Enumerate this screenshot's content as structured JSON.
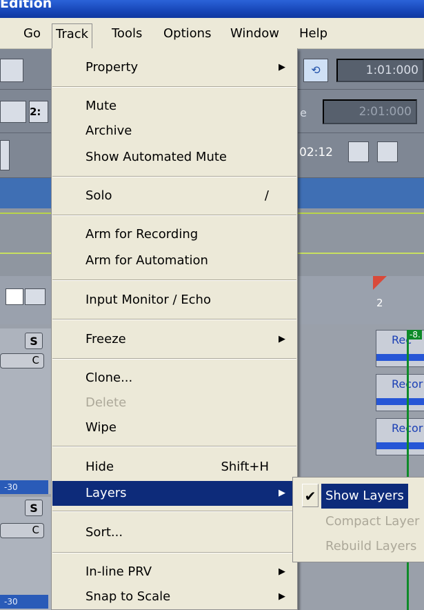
{
  "window": {
    "title": "Edition"
  },
  "menubar": {
    "items": [
      "Go",
      "Track",
      "Tools",
      "Options",
      "Window",
      "Help"
    ]
  },
  "toolbar": {
    "time_main": "1:01:000",
    "time_secondary": "2:01:000",
    "time_secondary_label": "e",
    "time_small": "02:12",
    "marker_label": "2:"
  },
  "track_menu": {
    "items": [
      {
        "label": "Property"
      },
      {
        "label": "Mute"
      },
      {
        "label": "Archive"
      },
      {
        "label": "Show Automated Mute"
      },
      {
        "label": "Solo",
        "shortcut": "/"
      },
      {
        "label": "Arm for Recording"
      },
      {
        "label": "Arm for Automation"
      },
      {
        "label": "Input Monitor / Echo"
      },
      {
        "label": "Freeze"
      },
      {
        "label": "Clone..."
      },
      {
        "label": "Delete"
      },
      {
        "label": "Wipe"
      },
      {
        "label": "Hide",
        "shortcut": "Shift+H"
      },
      {
        "label": "Layers"
      },
      {
        "label": "Sort..."
      },
      {
        "label": "In-line PRV"
      },
      {
        "label": "Snap to Scale"
      }
    ]
  },
  "layers_submenu": {
    "items": [
      {
        "label": "Show Layers",
        "checked": true
      },
      {
        "label": "Compact Layer"
      },
      {
        "label": "Rebuild Layers"
      }
    ]
  },
  "timeline": {
    "ruler_marker": "2",
    "playhead_label": "-8."
  },
  "clips": [
    "Rec",
    "Recor",
    "Recor"
  ],
  "track_controls": {
    "solo_label": "S",
    "pan_label": "C",
    "meter_label": "-30"
  }
}
